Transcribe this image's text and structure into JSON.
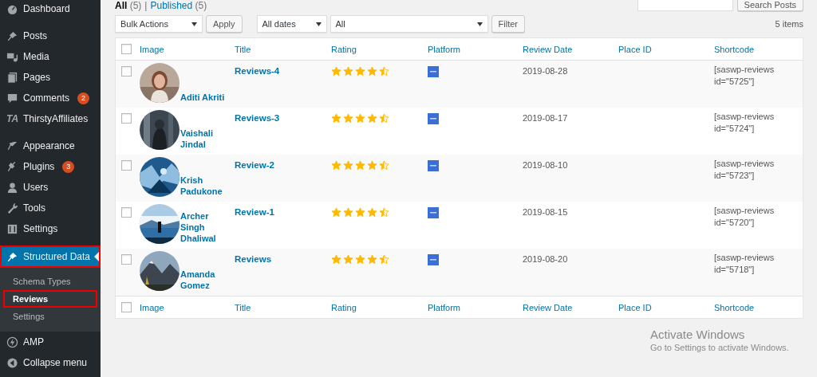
{
  "sidebar": {
    "sections": [
      [
        {
          "label": "Dashboard"
        }
      ],
      [
        {
          "label": "Posts"
        },
        {
          "label": "Media"
        },
        {
          "label": "Pages"
        },
        {
          "label": "Comments",
          "badge": "2"
        },
        {
          "label": "ThirstyAffiliates",
          "icon_text": "TA"
        }
      ],
      [
        {
          "label": "Appearance"
        },
        {
          "label": "Plugins",
          "badge": "3"
        },
        {
          "label": "Users"
        },
        {
          "label": "Tools"
        },
        {
          "label": "Settings"
        }
      ],
      [
        {
          "label": "Structured Data",
          "current": true,
          "highlighted": true,
          "children": [
            {
              "label": "Schema Types",
              "selected": false,
              "highlighted": false
            },
            {
              "label": "Reviews",
              "selected": true,
              "highlighted": true
            },
            {
              "label": "Settings",
              "selected": false,
              "highlighted": false
            }
          ]
        },
        {
          "label": "AMP"
        },
        {
          "label": "Collapse menu"
        }
      ]
    ]
  },
  "filters": [
    {
      "label": "All",
      "count": "(5)",
      "selected": true
    },
    {
      "label": "Published",
      "count": "(5)",
      "selected": false
    }
  ],
  "filter_separator": "|",
  "search": {
    "button": "Search Posts"
  },
  "toolbar": {
    "bulk_actions": "Bulk Actions",
    "apply": "Apply",
    "dates": "All dates",
    "platform": "All",
    "filter": "Filter",
    "items_count": "5 items"
  },
  "table": {
    "select_all_checked": false,
    "footer_select_all_checked": false,
    "columns": [
      "Image",
      "Title",
      "Rating",
      "Platform",
      "Review Date",
      "Place ID",
      "Shortcode"
    ],
    "rows": [
      {
        "checked": false,
        "name": "Aditi Akriti",
        "title": "Reviews-4",
        "stars": 4.5,
        "date": "2019-08-28",
        "shortcode": "[saswp-reviews id=\"5725\"]"
      },
      {
        "checked": false,
        "name": "Vaishali Jindal",
        "title": "Reviews-3",
        "stars": 4.5,
        "date": "2019-08-17",
        "shortcode": "[saswp-reviews id=\"5724\"]"
      },
      {
        "checked": false,
        "name": "Krish Padukone",
        "title": "Review-2",
        "stars": 4.5,
        "date": "2019-08-10",
        "shortcode": "[saswp-reviews id=\"5723\"]"
      },
      {
        "checked": false,
        "name": "Archer Singh Dhaliwal",
        "title": "Review-1",
        "stars": 4.5,
        "date": "2019-08-15",
        "shortcode": "[saswp-reviews id=\"5720\"]"
      },
      {
        "checked": false,
        "name": "Amanda Gomez",
        "title": "Reviews",
        "stars": 4.5,
        "date": "2019-08-20",
        "shortcode": "[saswp-reviews id=\"5718\"]"
      }
    ],
    "footer_columns": [
      "Image",
      "Title",
      "Rating",
      "Platform",
      "Review Date",
      "Place ID",
      "Shortcode"
    ]
  },
  "os_notice": {
    "title": "Activate Windows",
    "subtitle": "Go to Settings to activate Windows."
  }
}
